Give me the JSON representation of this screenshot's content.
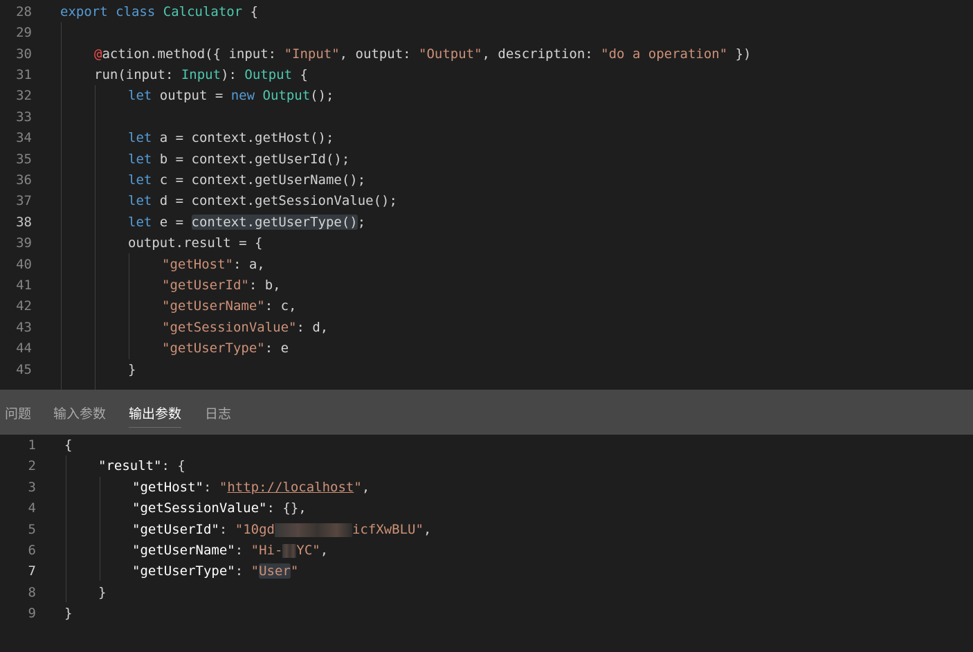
{
  "editor": {
    "lines": [
      {
        "n": "28"
      },
      {
        "n": "29"
      },
      {
        "n": "30"
      },
      {
        "n": "31"
      },
      {
        "n": "32"
      },
      {
        "n": "33"
      },
      {
        "n": "34"
      },
      {
        "n": "35"
      },
      {
        "n": "36"
      },
      {
        "n": "37"
      },
      {
        "n": "38"
      },
      {
        "n": "39"
      },
      {
        "n": "40"
      },
      {
        "n": "41"
      },
      {
        "n": "42"
      },
      {
        "n": "43"
      },
      {
        "n": "44"
      },
      {
        "n": "45"
      }
    ],
    "t": {
      "export": "export",
      "class": "class",
      "calculator": "Calculator",
      "brace_open": " {",
      "at": "@",
      "action_open": "action.method({ input: ",
      "input_str": "\"Input\"",
      "output_key": ", output: ",
      "output_str": "\"Output\"",
      "desc_key": ", description: ",
      "desc_str": "\"do a operation\"",
      "action_close": " })",
      "run": "run(",
      "input_param": "input",
      "colon": ": ",
      "input_type": "Input",
      "paren_close": "): ",
      "output_type": "Output",
      "let": "let",
      "output_var": " output = ",
      "new": "new",
      "output_ctor": "Output",
      "call_end": "();",
      "a_assign": " a = context.getHost();",
      "b_assign": " b = context.getUserId();",
      "c_assign": " c = context.getUserName();",
      "d_assign": " d = context.getSessionValue();",
      "e_assign": " e = ",
      "e_call": "context.getUserType()",
      "semi": ";",
      "result_open": "output.result = {",
      "k_host": "\"getHost\"",
      "v_host": ": a,",
      "k_uid": "\"getUserId\"",
      "v_uid": ": b,",
      "k_uname": "\"getUserName\"",
      "v_uname": ": c,",
      "k_sess": "\"getSessionValue\"",
      "v_sess": ": d,",
      "k_utype": "\"getUserType\"",
      "v_utype": ": e",
      "close_brace": "}"
    }
  },
  "tabs": [
    {
      "label": "问题"
    },
    {
      "label": "输入参数"
    },
    {
      "label": "输出参数"
    },
    {
      "label": "日志"
    }
  ],
  "output": {
    "lines": [
      {
        "n": "1"
      },
      {
        "n": "2"
      },
      {
        "n": "3"
      },
      {
        "n": "4"
      },
      {
        "n": "5"
      },
      {
        "n": "6"
      },
      {
        "n": "7"
      },
      {
        "n": "8"
      },
      {
        "n": "9"
      }
    ],
    "t": {
      "open": "{",
      "result_key": "\"result\"",
      "colon_brace": ": {",
      "q": "\"",
      "k_host": "getHost",
      "url": "http://localhost",
      "comma": ",",
      "colon": ": ",
      "k_sess": "getSessionValue",
      "sess_val": ": {},",
      "k_uid": "getUserId",
      "uid_start": "\"10gd",
      "uid_end": "icfXwBLU\"",
      "k_uname": "getUserName",
      "uname_start": "\"Hi-",
      "uname_end": "YC\"",
      "k_utype": "getUserType",
      "utype_val": "User",
      "close": "}"
    }
  }
}
